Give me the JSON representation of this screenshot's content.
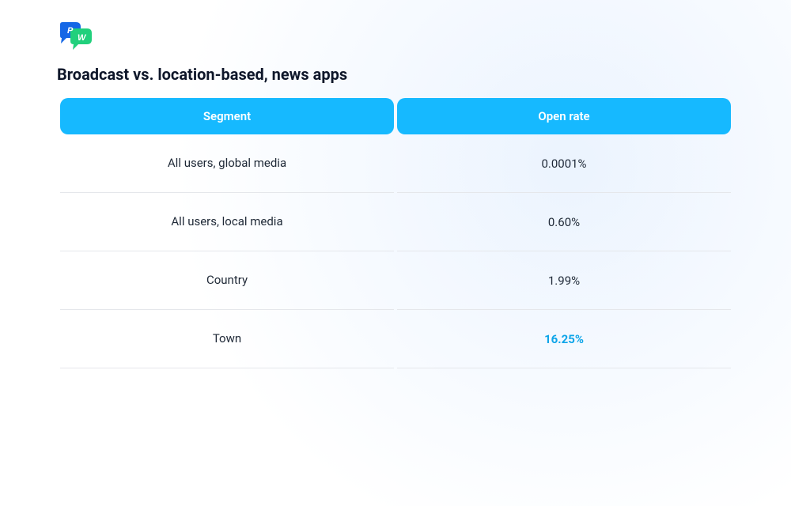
{
  "title": "Broadcast vs. location-based, news apps",
  "columns": {
    "segment": "Segment",
    "open_rate": "Open rate"
  },
  "rows": [
    {
      "segment": "All users, global media",
      "open_rate": "0.0001%",
      "highlight": false
    },
    {
      "segment": "All users, local media",
      "open_rate": "0.60%",
      "highlight": false
    },
    {
      "segment": "Country",
      "open_rate": "1.99%",
      "highlight": false
    },
    {
      "segment": "Town",
      "open_rate": "16.25%",
      "highlight": true
    }
  ],
  "chart_data": {
    "type": "table",
    "title": "Broadcast vs. location-based, news apps",
    "columns": [
      "Segment",
      "Open rate"
    ],
    "rows": [
      [
        "All users, global media",
        "0.0001%"
      ],
      [
        "All users, local media",
        "0.60%"
      ],
      [
        "Country",
        "1.99%"
      ],
      [
        "Town",
        "16.25%"
      ]
    ]
  }
}
